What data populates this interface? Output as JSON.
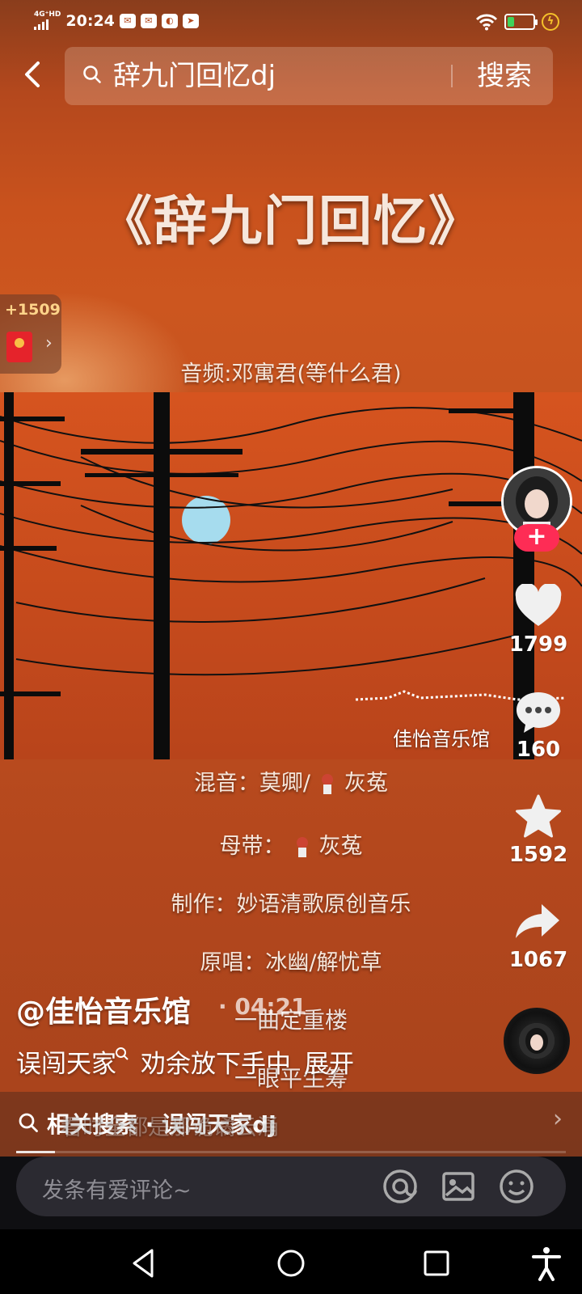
{
  "status": {
    "time": "20:24",
    "network": "4G⁺HD",
    "notification_icons": [
      "mail-icon",
      "mail-icon",
      "app-icon",
      "send-icon"
    ],
    "battery_percent": 0.28
  },
  "search": {
    "query": "辞九门回忆dj",
    "button": "搜索"
  },
  "video": {
    "title": "《辞九门回忆》",
    "credits": {
      "audio": "音频:邓寓君(等什么君)",
      "mix": "混音：莫卿/",
      "mix_person": "灰菟",
      "master_label": "母带：",
      "master_person": "灰菟",
      "producer": "制作：妙语清歌原创音乐",
      "original": "原唱：冰幽/解忧草"
    },
    "watermark": "佳怡音乐馆"
  },
  "red_packet": {
    "count": "+1509"
  },
  "actions": {
    "likes": "1799",
    "comments": "160",
    "favorites": "1592",
    "shares": "1067"
  },
  "info": {
    "author": "@佳怡音乐馆",
    "duration": "· 04:21",
    "desc_part1": "误闯天家",
    "desc_part2": "劝余放下手中",
    "expand": "展开"
  },
  "lyrics": {
    "line1": "一曲定重楼",
    "line2": "一眼平生筹",
    "line3": "看时全都是那诡谲云涌"
  },
  "related": {
    "label": "相关搜索 · 误闯天家dj"
  },
  "playback": {
    "progress": 0.07
  },
  "comment": {
    "placeholder": "发条有爱评论~"
  }
}
